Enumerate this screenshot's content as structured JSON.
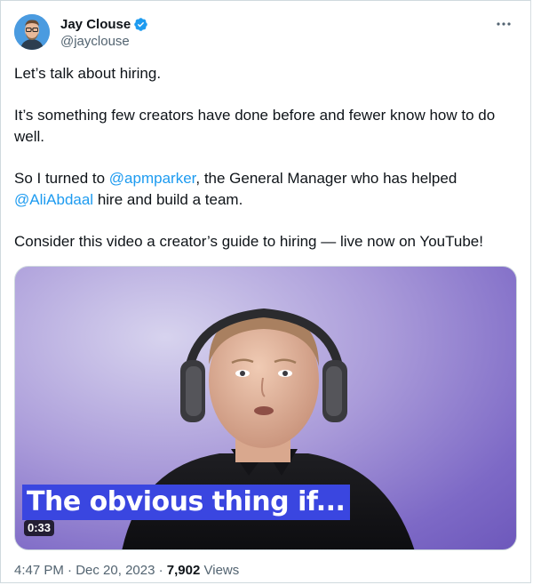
{
  "author": {
    "display_name": "Jay Clouse",
    "handle": "@jayclouse",
    "verified": true,
    "avatar_icon": "avatar-photo"
  },
  "more_icon": "more-horizontal-icon",
  "tweet": {
    "line1": "Let’s talk about hiring.",
    "line2": "It’s something few creators have done before and fewer know how to do well.",
    "line3_pre": "So I turned to ",
    "mention1": "@apmparker",
    "line3_mid": ", the General Manager who has helped ",
    "mention2": "@AliAbdaal",
    "line3_post": " hire and build a team.",
    "line4": "Consider this video a creator’s guide to hiring — live now on YouTube!"
  },
  "media": {
    "caption": "The obvious thing if...",
    "duration": "0:33"
  },
  "meta": {
    "time": "4:47 PM",
    "separator1": " · ",
    "date": "Dec 20, 2023",
    "separator2": " · ",
    "views_count": "7,902",
    "views_label": " Views"
  },
  "colors": {
    "link": "#1d9bf0",
    "text": "#0f1419",
    "secondary": "#536471",
    "caption_bg": "#3a46e0"
  }
}
